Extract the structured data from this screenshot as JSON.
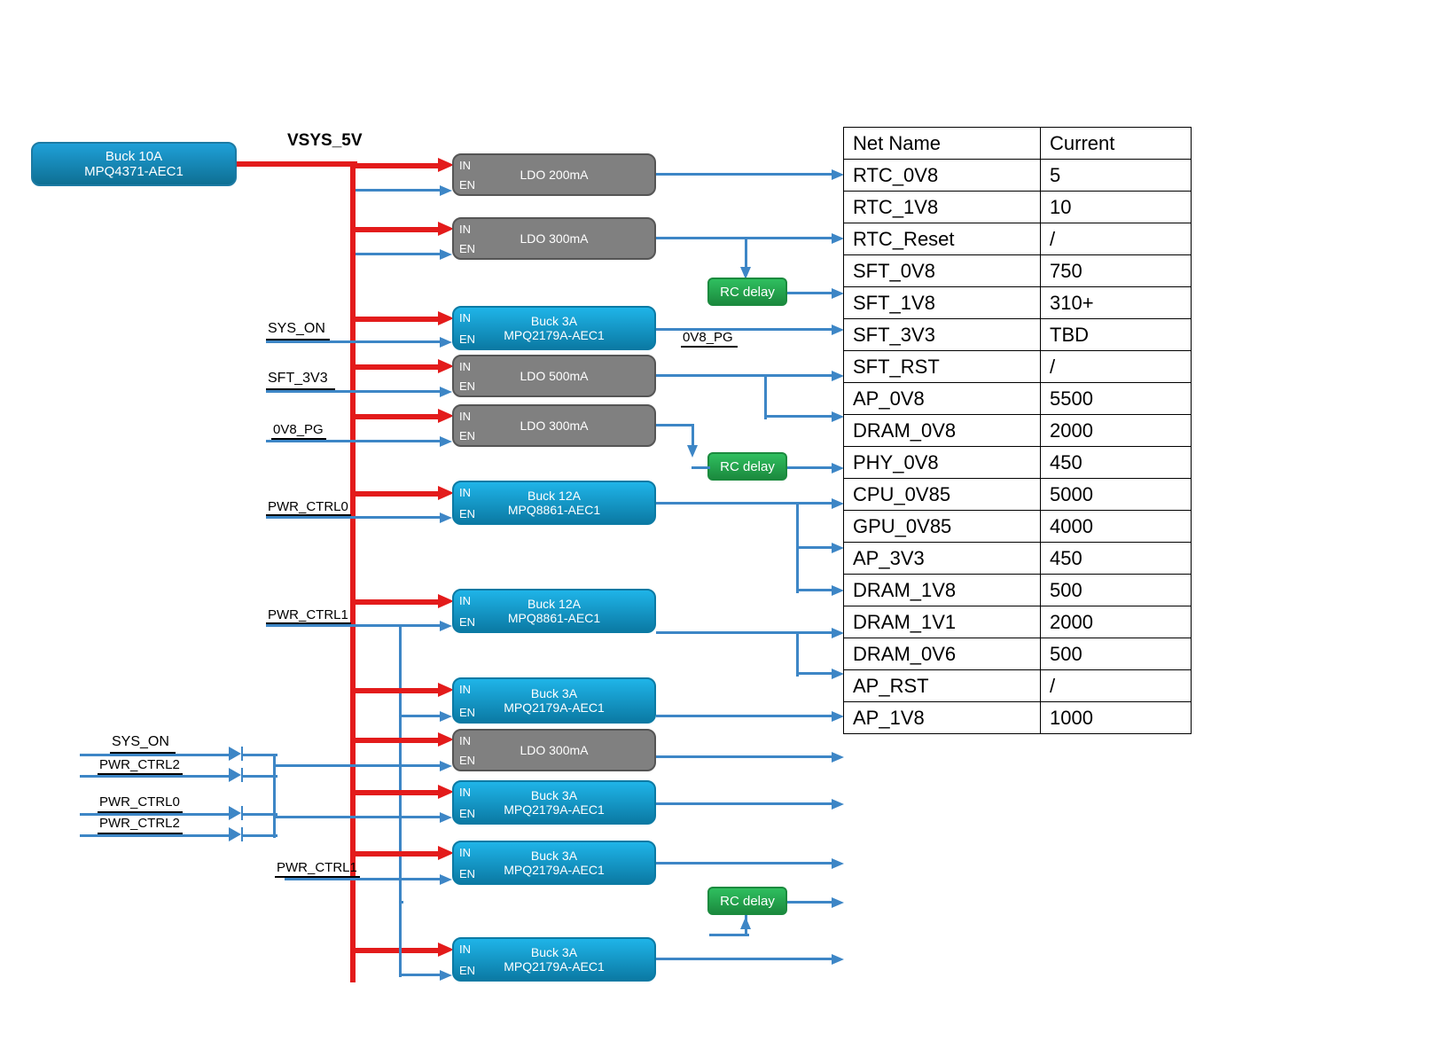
{
  "bus_label": "VSYS_5V",
  "source": {
    "title": "Buck 10A",
    "part": "MPQ4371-AEC1"
  },
  "regs": [
    {
      "kind": "ldo",
      "title": "LDO 200mA",
      "part": ""
    },
    {
      "kind": "ldo",
      "title": "LDO 300mA",
      "part": ""
    },
    {
      "kind": "buck",
      "title": "Buck 3A",
      "part": "MPQ2179A-AEC1",
      "out_note": "0V8_PG"
    },
    {
      "kind": "ldo",
      "title": "LDO 500mA",
      "part": ""
    },
    {
      "kind": "ldo",
      "title": "LDO 300mA",
      "part": ""
    },
    {
      "kind": "buck",
      "title": "Buck 12A",
      "part": "MPQ8861-AEC1"
    },
    {
      "kind": "buck",
      "title": "Buck 12A",
      "part": "MPQ8861-AEC1"
    },
    {
      "kind": "buck",
      "title": "Buck 3A",
      "part": "MPQ2179A-AEC1"
    },
    {
      "kind": "ldo",
      "title": "LDO 300mA",
      "part": ""
    },
    {
      "kind": "buck",
      "title": "Buck 3A",
      "part": "MPQ2179A-AEC1"
    },
    {
      "kind": "buck",
      "title": "Buck 3A",
      "part": "MPQ2179A-AEC1"
    },
    {
      "kind": "buck",
      "title": "Buck 3A",
      "part": "MPQ2179A-AEC1"
    }
  ],
  "en_signals": {
    "sys_on": "SYS_ON",
    "sft_3v3": "SFT_3V3",
    "0v8_pg": "0V8_PG",
    "pwr_ctrl0": "PWR_CTRL0",
    "pwr_ctrl1": "PWR_CTRL1",
    "pwr_ctrl2": "PWR_CTRL2"
  },
  "pins": {
    "in": "IN",
    "en": "EN"
  },
  "rc_delay": "RC delay",
  "table": {
    "header": {
      "c1": "Net Name",
      "c2": "Current"
    },
    "rows": [
      {
        "c1": "RTC_0V8",
        "c2": "5"
      },
      {
        "c1": "RTC_1V8",
        "c2": "10"
      },
      {
        "c1": "RTC_Reset",
        "c2": "/"
      },
      {
        "c1": "SFT_0V8",
        "c2": "750"
      },
      {
        "c1": "SFT_1V8",
        "c2": "310+"
      },
      {
        "c1": "SFT_3V3",
        "c2": "TBD"
      },
      {
        "c1": "SFT_RST",
        "c2": "/"
      },
      {
        "c1": "AP_0V8",
        "c2": "5500"
      },
      {
        "c1": "DRAM_0V8",
        "c2": "2000"
      },
      {
        "c1": "PHY_0V8",
        "c2": "450"
      },
      {
        "c1": "CPU_0V85",
        "c2": "5000"
      },
      {
        "c1": "GPU_0V85",
        "c2": "4000"
      },
      {
        "c1": "AP_3V3",
        "c2": "450"
      },
      {
        "c1": "DRAM_1V8",
        "c2": "500"
      },
      {
        "c1": "DRAM_1V1",
        "c2": "2000"
      },
      {
        "c1": "DRAM_0V6",
        "c2": "500"
      },
      {
        "c1": "AP_RST",
        "c2": "/"
      },
      {
        "c1": "AP_1V8",
        "c2": "1000"
      }
    ]
  }
}
